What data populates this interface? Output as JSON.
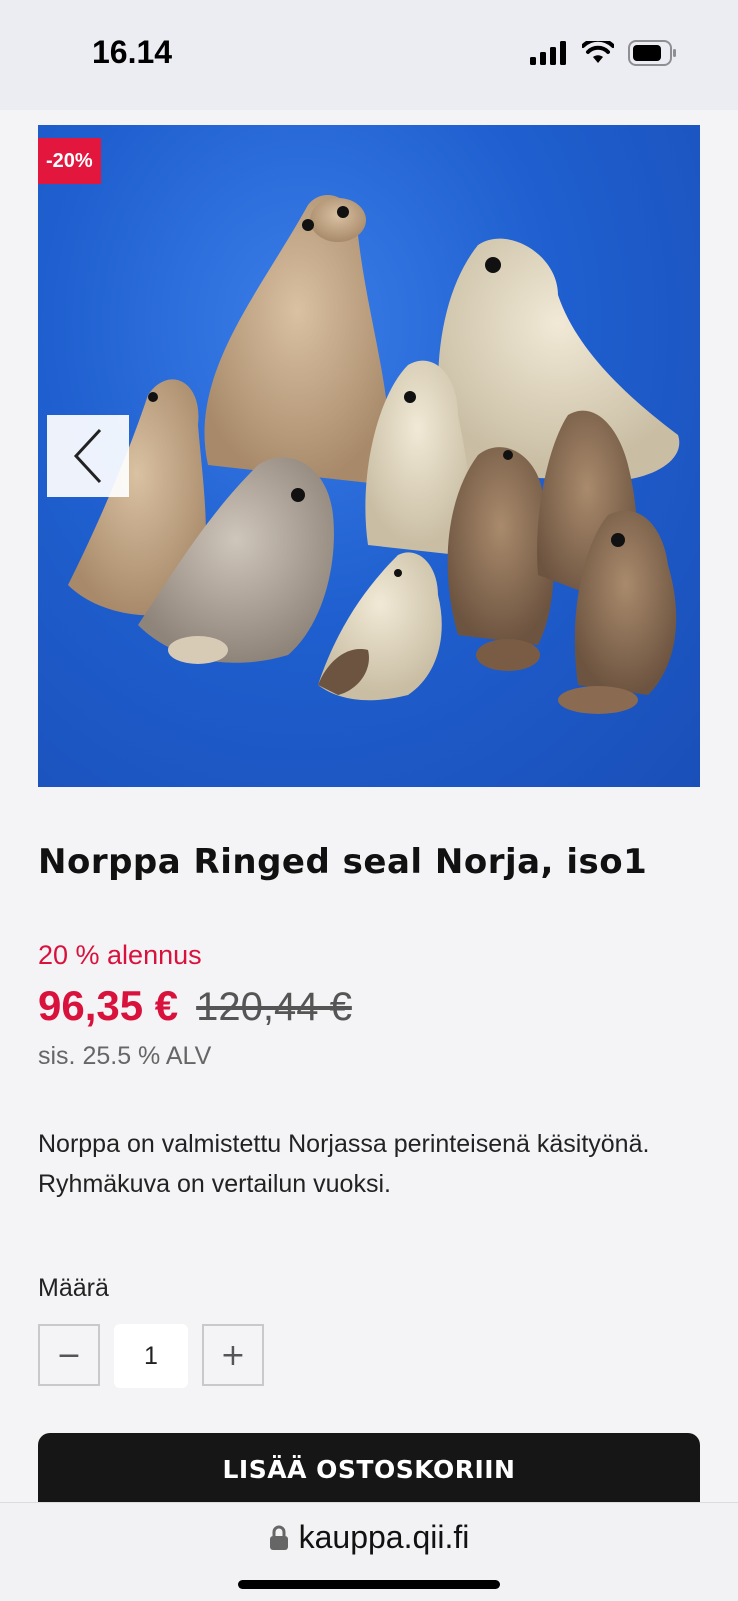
{
  "status_bar": {
    "time": "16.14",
    "icons": [
      "cellular-signal-icon",
      "wifi-icon",
      "battery-icon"
    ]
  },
  "product": {
    "badge": "-20%",
    "image_alt": "Norppa Ringed seal Norja, iso1",
    "title": "Norppa Ringed seal Norja, iso1",
    "discount_text": "20 % alennus",
    "price_now": "96,35 €",
    "price_was": "120,44 €",
    "vat": "sis. 25.5 % ALV",
    "description": "Norppa on valmistettu Norjassa perinteisenä käsityönä. Ryhmäkuva on vertailun vuoksi."
  },
  "quantity": {
    "label": "Määrä",
    "minus": "−",
    "value": "1",
    "plus": "+"
  },
  "add_to_cart_label": "LISÄÄ OSTOSKORIIN",
  "browser": {
    "url": "kauppa.qii.fi"
  },
  "colors": {
    "accent_red": "#e3173e",
    "button_dark": "#161616",
    "image_background_blue": "#1f5fcf"
  }
}
